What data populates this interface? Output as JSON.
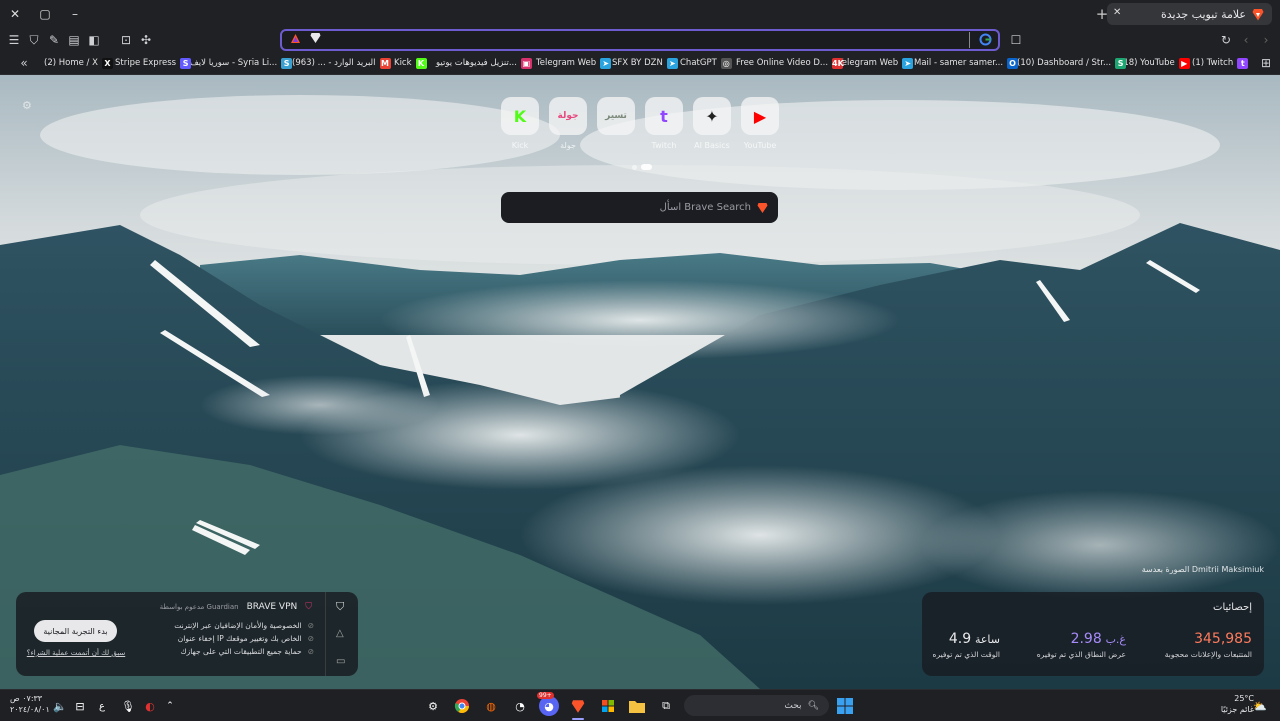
{
  "window": {
    "minimize": "–",
    "maximize": "▢",
    "close": "✕"
  },
  "tab": {
    "title": "علامة تبويب جديدة",
    "new_tab": "+"
  },
  "omnibox": {
    "value": "",
    "placeholder": ""
  },
  "bookmarks": [
    {
      "label": "(1) Twitch",
      "color": "#9146ff",
      "glyph": "t"
    },
    {
      "label": "(18) YouTube",
      "color": "#ff0000",
      "glyph": "▶"
    },
    {
      "label": "(10) Dashboard / Str...",
      "color": "#1ea672",
      "glyph": "S"
    },
    {
      "label": "Mail - samer samer...",
      "color": "#0a64c9",
      "glyph": "O"
    },
    {
      "label": "Telegram Web",
      "color": "#2aa3de",
      "glyph": "➤"
    },
    {
      "label": "Free Online Video D...",
      "color": "#e03131",
      "glyph": "4K"
    },
    {
      "label": "ChatGPT",
      "color": "#555",
      "glyph": "◎"
    },
    {
      "label": "SFX BY DZN",
      "color": "#2aa3de",
      "glyph": "➤"
    },
    {
      "label": "Telegram Web",
      "color": "#2aa3de",
      "glyph": "➤"
    },
    {
      "label": "تنزيل فيديوهات يوتيو...",
      "color": "#d6336c",
      "glyph": "▣"
    },
    {
      "label": "Kick",
      "color": "#53fc18",
      "glyph": "K"
    },
    {
      "label": "البريد الوارد - ... (963)",
      "color": "#ea4335",
      "glyph": "M"
    },
    {
      "label": "سوريا لايف - Syria Li...",
      "color": "#3aa0d0",
      "glyph": "S"
    },
    {
      "label": "Stripe Express",
      "color": "#635bff",
      "glyph": "S"
    },
    {
      "label": "(2) Home / X",
      "color": "#111",
      "glyph": "X"
    }
  ],
  "top_sites": [
    {
      "label": "YouTube",
      "icon": "youtube-icon",
      "glyph": "▶",
      "color": "#ff0000"
    },
    {
      "label": "AI Basics",
      "icon": "game-icon",
      "glyph": "✦",
      "color": "#222"
    },
    {
      "label": "Twitch",
      "icon": "twitch-icon",
      "glyph": "t",
      "color": "#9146ff"
    },
    {
      "label": "",
      "icon": "text-logo-icon",
      "glyph": "تسير",
      "color": "#7c8a7c"
    },
    {
      "label": "جولة",
      "icon": "text-logo-icon",
      "glyph": "جولة",
      "color": "#e64980"
    },
    {
      "label": "Kick",
      "icon": "kick-icon",
      "glyph": "K",
      "color": "#53fc18"
    }
  ],
  "search": {
    "placeholder": "اسأل Brave Search"
  },
  "photo_credit": "الصورة بعدسة Dmitrii Maksimiuk",
  "stats": {
    "title": "إحصائيات",
    "items": [
      {
        "value": "345,985",
        "unit": "",
        "label": "المتتبعات والإعلانات محجوبة",
        "color": "#ff7a5c"
      },
      {
        "value": "2.98",
        "unit": "غ.ب",
        "label": "عرض النطاق الذي تم توفيره",
        "color": "#a78bfa"
      },
      {
        "value": "4.9",
        "unit": "ساعة",
        "label": "الوقت الذي تم توفيره",
        "color": "#ffffff"
      }
    ]
  },
  "vpn": {
    "title": "BRAVE VPN",
    "powered": "مدعوم بواسطة Guardian",
    "features": [
      "الخصوصية والأمان الإضافيان عبر الإنترنت",
      "إخفاء عنوان IP الخاص بك وتغيير موقعك",
      "حماية جميع التطبيقات التي على جهازك"
    ],
    "trial_button": "بدء التجربة المجانية",
    "purchased_link": "سبق لك أن أتممت عملية الشراء؟"
  },
  "taskbar": {
    "search_placeholder": "بحث",
    "time": "٠٧:٣٣ ص",
    "date": "٢٠٢٤/٠٨/٠١",
    "temp": "25°C",
    "weather_text": "غائم جزئيًا",
    "lang": "ع",
    "badge_count": "99+"
  }
}
